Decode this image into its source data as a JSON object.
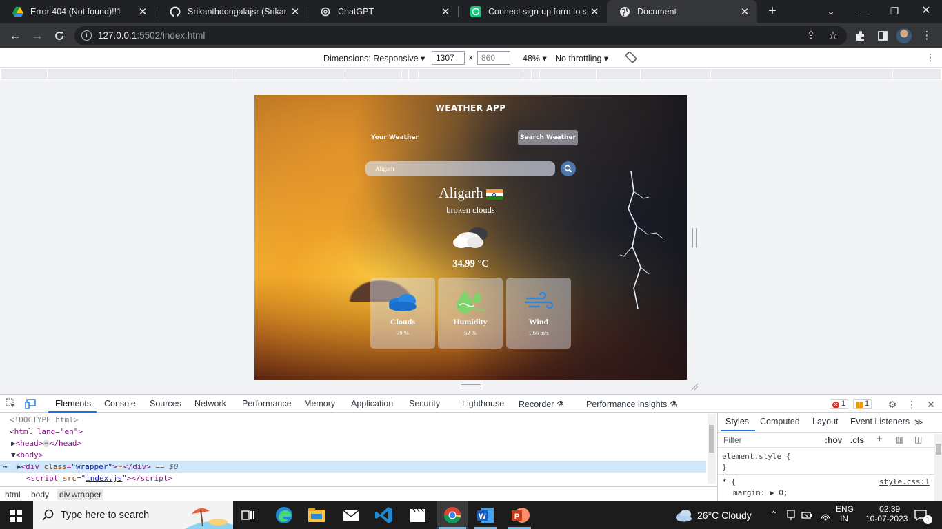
{
  "browser": {
    "tabs": [
      {
        "title": "Error 404 (Not found)!!1",
        "icon": "google-drive-icon",
        "active": false
      },
      {
        "title": "Srikanthdongalajsr (Srikanth",
        "icon": "github-icon",
        "active": false
      },
      {
        "title": "ChatGPT",
        "icon": "chatgpt-icon",
        "active": false
      },
      {
        "title": "Connect sign-up form to serv",
        "icon": "chatgpt-icon",
        "active": false
      },
      {
        "title": "Document",
        "icon": "globe-icon",
        "active": true
      }
    ],
    "url_host": "127.0.0.1",
    "url_rest": ":5502/index.html"
  },
  "device_toolbar": {
    "dimensions_label": "Dimensions: Responsive",
    "width": "1307",
    "height_placeholder": "860",
    "times": "×",
    "zoom": "48%",
    "throttling": "No throttling"
  },
  "weather_app": {
    "title": "WEATHER APP",
    "tab_your": "Your Weather",
    "tab_search": "Search Weather",
    "search_value": "Aligarh",
    "city": "Aligarh",
    "description": "broken clouds",
    "temperature": "34.99 °C",
    "cards": [
      {
        "title": "Clouds",
        "value": "79 %",
        "icon": "clouds-icon"
      },
      {
        "title": "Humidity",
        "value": "52 %",
        "icon": "humidity-icon"
      },
      {
        "title": "Wind",
        "value": "1.66 m/s",
        "icon": "wind-icon"
      }
    ]
  },
  "devtools": {
    "tabs": [
      "Elements",
      "Console",
      "Sources",
      "Network",
      "Performance",
      "Memory",
      "Application",
      "Security",
      "Lighthouse",
      "Recorder",
      "Performance insights"
    ],
    "errors": "1",
    "warnings": "1",
    "code": {
      "doctype": "<!DOCTYPE html>",
      "html_open": "<html lang=\"en\">",
      "head": "head",
      "body": "body",
      "div_class": "wrapper",
      "selected_marker": "== $0",
      "script_src": "index.js"
    },
    "breadcrumbs": [
      "html",
      "body",
      "div.wrapper"
    ],
    "styles_tabs": [
      "Styles",
      "Computed",
      "Layout",
      "Event Listeners"
    ],
    "filter_placeholder": "Filter",
    "hov": ":hov",
    "cls": ".cls",
    "element_style": "element.style {",
    "close_brace": "}",
    "star_rule": "* {",
    "stylesheet": "style.css:1",
    "margin_line": "margin: ▶ 0;"
  },
  "taskbar": {
    "search_placeholder": "Type here to search",
    "weather_temp": "26°C",
    "weather_text": "Cloudy",
    "lang": "ENG",
    "region": "IN",
    "time": "02:39",
    "date": "10-07-2023",
    "notifications": "1"
  }
}
